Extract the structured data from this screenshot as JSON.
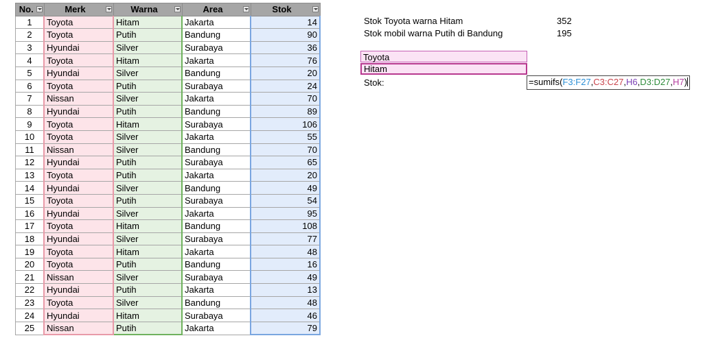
{
  "table": {
    "headers": [
      "No.",
      "Merk",
      "Warna",
      "Area",
      "Stok"
    ],
    "rows": [
      [
        "1",
        "Toyota",
        "Hitam",
        "Jakarta",
        "14"
      ],
      [
        "2",
        "Toyota",
        "Putih",
        "Bandung",
        "90"
      ],
      [
        "3",
        "Hyundai",
        "Silver",
        "Surabaya",
        "36"
      ],
      [
        "4",
        "Toyota",
        "Hitam",
        "Jakarta",
        "76"
      ],
      [
        "5",
        "Hyundai",
        "Silver",
        "Bandung",
        "20"
      ],
      [
        "6",
        "Toyota",
        "Putih",
        "Surabaya",
        "24"
      ],
      [
        "7",
        "Nissan",
        "Silver",
        "Jakarta",
        "70"
      ],
      [
        "8",
        "Hyundai",
        "Putih",
        "Bandung",
        "89"
      ],
      [
        "9",
        "Toyota",
        "Hitam",
        "Surabaya",
        "106"
      ],
      [
        "10",
        "Toyota",
        "Silver",
        "Jakarta",
        "55"
      ],
      [
        "11",
        "Nissan",
        "Silver",
        "Bandung",
        "70"
      ],
      [
        "12",
        "Hyundai",
        "Putih",
        "Surabaya",
        "65"
      ],
      [
        "13",
        "Toyota",
        "Putih",
        "Jakarta",
        "20"
      ],
      [
        "14",
        "Hyundai",
        "Silver",
        "Bandung",
        "49"
      ],
      [
        "15",
        "Toyota",
        "Putih",
        "Surabaya",
        "54"
      ],
      [
        "16",
        "Hyundai",
        "Silver",
        "Jakarta",
        "95"
      ],
      [
        "17",
        "Toyota",
        "Hitam",
        "Bandung",
        "108"
      ],
      [
        "18",
        "Hyundai",
        "Silver",
        "Surabaya",
        "77"
      ],
      [
        "19",
        "Toyota",
        "Hitam",
        "Jakarta",
        "48"
      ],
      [
        "20",
        "Toyota",
        "Putih",
        "Bandung",
        "16"
      ],
      [
        "21",
        "Nissan",
        "Silver",
        "Surabaya",
        "49"
      ],
      [
        "22",
        "Hyundai",
        "Putih",
        "Jakarta",
        "13"
      ],
      [
        "23",
        "Toyota",
        "Silver",
        "Bandung",
        "48"
      ],
      [
        "24",
        "Hyundai",
        "Hitam",
        "Surabaya",
        "46"
      ],
      [
        "25",
        "Nissan",
        "Putih",
        "Jakarta",
        "79"
      ]
    ]
  },
  "summary": [
    {
      "label": "Stok Toyota warna Hitam",
      "value": "352"
    },
    {
      "label": "Stok mobil warna Putih di Bandung",
      "value": "195"
    }
  ],
  "criteria": {
    "merk": "Toyota",
    "warna": "Hitam",
    "stok_label": "Stok:"
  },
  "formula": {
    "prefix": "=sumifs(",
    "range_sum": "F3:F27",
    "sep1": ",",
    "range_merk": "C3:C27",
    "sep2": ",",
    "crit_merk": "H6",
    "sep3": ",",
    "range_warna": "D3:D27",
    "sep4": ",",
    "crit_warna": "H7",
    "suffix": ")"
  },
  "colors": {
    "merk_column": "#fde4e9",
    "warna_column": "#e5f2e2",
    "stok_column": "#e2ecfb",
    "header_bg": "#a6a6a6",
    "criteria_bg": "#fbe3f5"
  },
  "icons": {
    "header_filter": "filter-dropdown-icon"
  }
}
